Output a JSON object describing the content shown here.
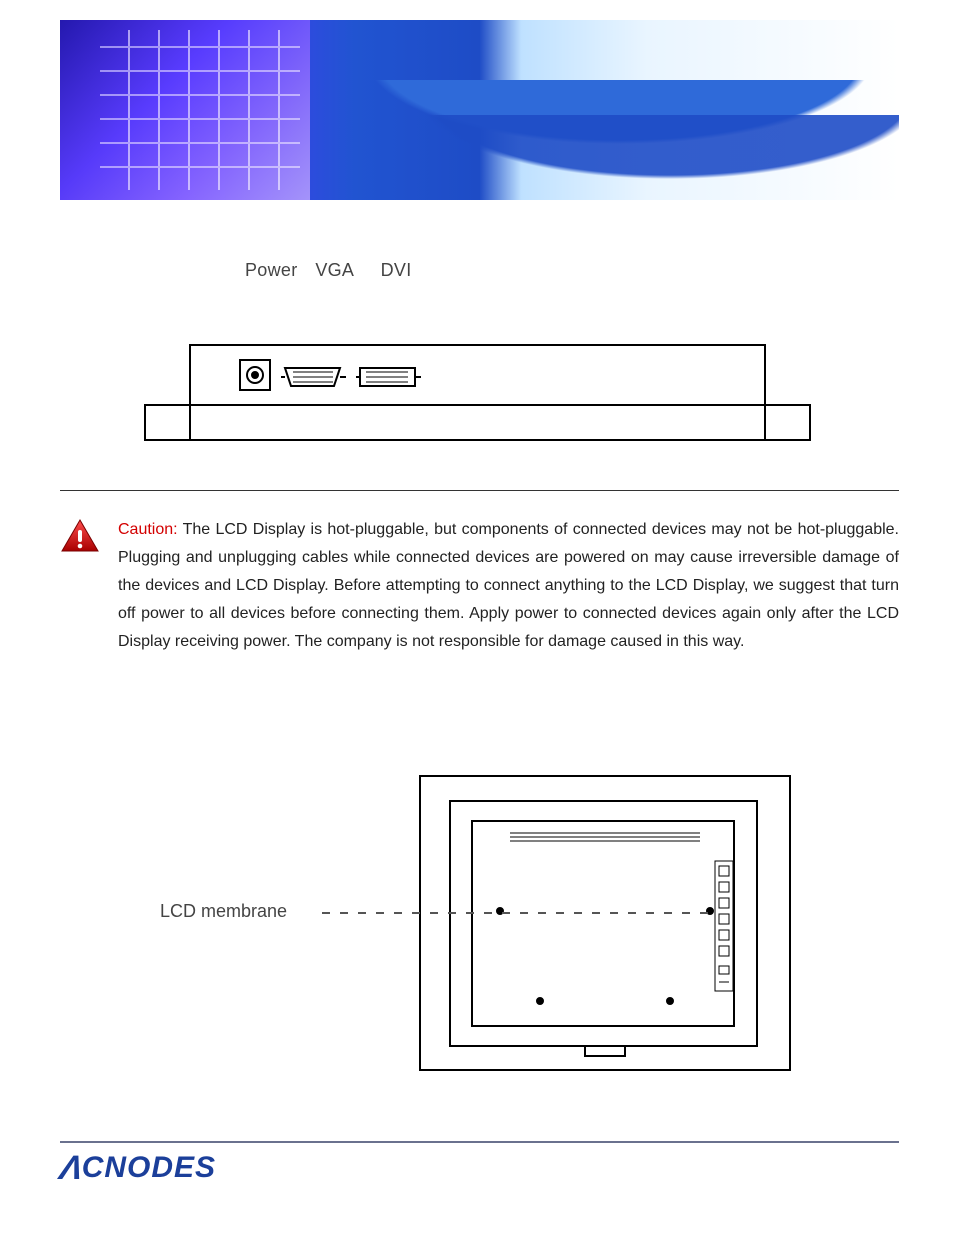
{
  "connectors": {
    "power": "Power",
    "vga": "VGA",
    "dvi": "DVI"
  },
  "caution": {
    "label": "Caution:",
    "text": " The LCD Display is hot-pluggable, but components of connected devices may not be hot-pluggable. Plugging and unplugging cables while connected devices are powered on may cause irreversible damage of the devices and LCD Display. Before attempting to connect anything to the LCD Display, we suggest that turn off power to all devices before connecting them. Apply power to connected devices again only after the LCD Display receiving power. The company is not responsible for damage caused in this way."
  },
  "back_panel": {
    "membrane_label": "LCD membrane"
  },
  "footer": {
    "brand": "CNODES"
  }
}
